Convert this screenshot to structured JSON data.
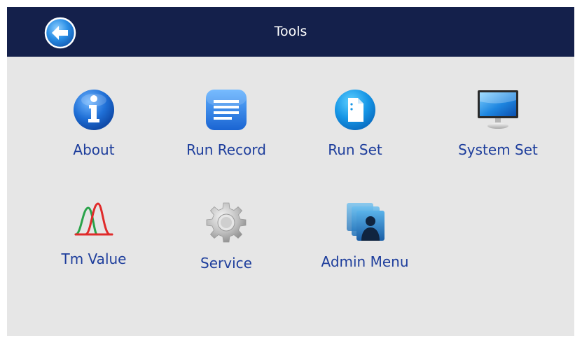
{
  "header": {
    "title": "Tools",
    "back_icon": "back-arrow-icon"
  },
  "menu": {
    "items": [
      {
        "label": "About",
        "icon": "info-icon"
      },
      {
        "label": "Run Record",
        "icon": "document-list-icon"
      },
      {
        "label": "Run Set",
        "icon": "file-settings-icon"
      },
      {
        "label": "System Set",
        "icon": "monitor-icon"
      },
      {
        "label": "Tm Value",
        "icon": "melting-curve-icon"
      },
      {
        "label": "Service",
        "icon": "gear-icon"
      },
      {
        "label": "Admin Menu",
        "icon": "admin-users-icon"
      }
    ]
  },
  "colors": {
    "header_bg": "#14204b",
    "content_bg": "#e6e6e6",
    "label_color": "#1e3e9c",
    "accent_blue": "#1e90e8"
  }
}
